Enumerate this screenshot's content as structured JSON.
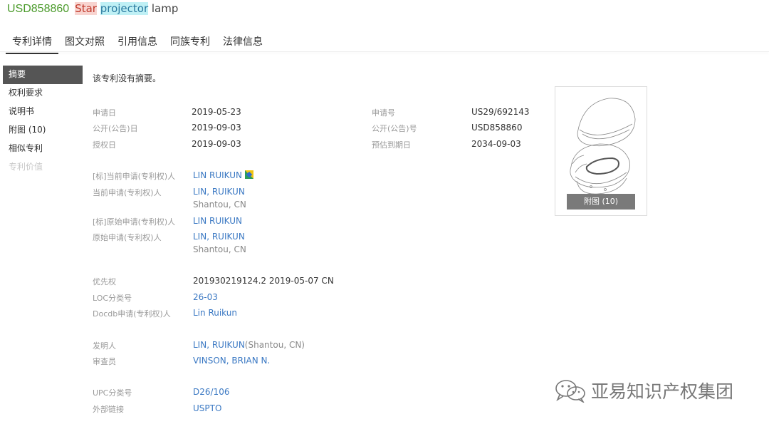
{
  "header": {
    "patent_number": "USD858860",
    "title_word_1": "Star",
    "title_word_2": "projector",
    "title_rest": " lamp"
  },
  "tabs": [
    "专利详情",
    "图文对照",
    "引用信息",
    "同族专利",
    "法律信息"
  ],
  "sidebar": {
    "items": [
      "摘要",
      "权利要求",
      "说明书",
      "附图 (10)",
      "相似专利",
      "专利价值"
    ]
  },
  "abstract_text": "该专利没有摘要。",
  "dates": {
    "application_date_label": "申请日",
    "application_date": "2019-05-23",
    "publication_date_label": "公开(公告)日",
    "publication_date": "2019-09-03",
    "grant_date_label": "授权日",
    "grant_date": "2019-09-03",
    "application_no_label": "申请号",
    "application_no": "US29/692143",
    "publication_no_label": "公开(公告)号",
    "publication_no": "USD858860",
    "expiry_label": "预估到期日",
    "expiry": "2034-09-03"
  },
  "applicants": {
    "std_current_label": "[标]当前申请(专利权)人",
    "std_current": "LIN RUIKUN",
    "current_label": "当前申请(专利权)人",
    "current": "LIN, RUIKUN",
    "current_loc": "Shantou, CN",
    "std_original_label": "[标]原始申请(专利权)人",
    "std_original": "LIN RUIKUN",
    "original_label": "原始申请(专利权)人",
    "original": "LIN, RUIKUN",
    "original_loc": "Shantou, CN"
  },
  "classification": {
    "priority_label": "优先权",
    "priority": "201930219124.2 2019-05-07 CN",
    "loc_label": "LOC分类号",
    "loc": "26-03",
    "docdb_label": "Docdb申请(专利权)人",
    "docdb": "Lin Ruikun"
  },
  "people": {
    "inventor_label": "发明人",
    "inventor_name": "LIN, RUIKUN",
    "inventor_loc": "(Shantou, CN)",
    "examiner_label": "审查员",
    "examiner": "VINSON, BRIAN N."
  },
  "links": {
    "upc_label": "UPC分类号",
    "upc": "D26/106",
    "external_label": "外部链接",
    "external": "USPTO"
  },
  "figure": {
    "button_label": "附图 (10)"
  },
  "watermark": "亚易知识产权集团",
  "colors": {
    "patent_number": "#4a9a2a",
    "link": "#3a78c3",
    "sidebar_active": "#555555"
  }
}
